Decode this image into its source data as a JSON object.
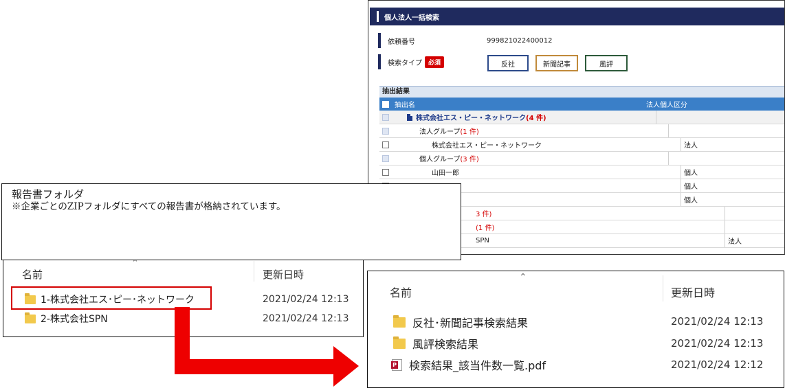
{
  "web_panel": {
    "title": "個人法人一括検索",
    "request_label": "依頼番号",
    "request_number": "999821022400012",
    "search_type_label": "検索タイプ",
    "required_badge": "必須",
    "type_buttons": [
      "反社",
      "新聞記事",
      "風評"
    ],
    "results_title": "抽出結果",
    "columns": [
      "抽出名",
      "法人個人区分"
    ],
    "rows": [
      {
        "name": "株式会社エス・ピー・ネットワーク",
        "count": "(4 件)",
        "type": ""
      },
      {
        "name": "法人グループ",
        "count": "(1 件)",
        "type": ""
      },
      {
        "name": "株式会社エス・ピー・ネットワーク",
        "count": "",
        "type": "法人"
      },
      {
        "name": "個人グループ",
        "count": "(3 件)",
        "type": ""
      },
      {
        "name": "山田一郎",
        "count": "",
        "type": "個人"
      },
      {
        "name": "",
        "count": "",
        "type": "個人"
      },
      {
        "name": "",
        "count": "",
        "type": "個人"
      },
      {
        "name": "",
        "count": "3 件)",
        "type": ""
      },
      {
        "name": "",
        "count": "(1 件)",
        "type": ""
      },
      {
        "name": "SPN",
        "count": "",
        "type": "法人"
      }
    ]
  },
  "callout": {
    "heading": "報告書フォルダ",
    "text": "※企業ごとのZIPフォルダにすべての報告書が格納されています。"
  },
  "explorer_left": {
    "col_name": "名前",
    "col_date": "更新日時",
    "items": [
      {
        "name": "1-株式会社エス･ピー･ネットワーク",
        "date": "2021/02/24 12:13",
        "icon": "folder-icon"
      },
      {
        "name": "2-株式会社SPN",
        "date": "2021/02/24 12:13",
        "icon": "folder-icon"
      }
    ]
  },
  "explorer_right": {
    "col_name": "名前",
    "col_date": "更新日時",
    "items": [
      {
        "name": "反社･新聞記事検索結果",
        "date": "2021/02/24 12:13",
        "icon": "folder-icon"
      },
      {
        "name": "風評検索結果",
        "date": "2021/02/24 12:13",
        "icon": "folder-icon"
      },
      {
        "name": "検索結果_該当件数一覧.pdf",
        "date": "2021/02/24 12:12",
        "icon": "pdf-icon"
      }
    ]
  },
  "colors": {
    "header_navy": "#1f2a5e",
    "table_head_blue": "#3a7fc8",
    "required_red": "#d40000",
    "arrow_red": "#ee0000",
    "folder_yellow": "#f2c94c"
  }
}
